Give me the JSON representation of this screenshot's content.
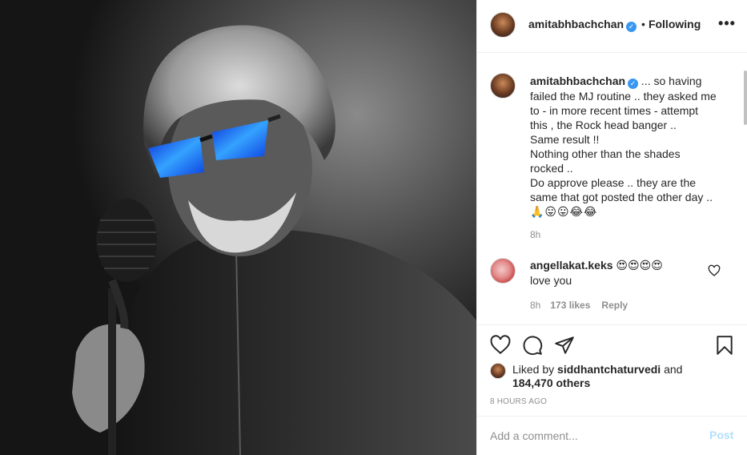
{
  "post": {
    "username": "amitabhbachchan",
    "follow_state": "Following",
    "more_icon": "more-horizontal-icon",
    "caption_lines": [
      "... so having",
      "failed the MJ routine .. they asked me",
      "to - in more recent times - attempt",
      "this , the Rock head banger ..",
      "Same result !!",
      "Nothing other than the shades",
      "rocked ..",
      "Do approve please .. they are the",
      "same that got posted the other day .."
    ],
    "caption_emojis": "🙏😛😛😂😂",
    "caption_time": "8h"
  },
  "comment": {
    "username": "angellakat.keks",
    "emojis": "😍😍😍😍",
    "text": "love you",
    "time": "8h",
    "likes": "173 likes",
    "reply": "Reply"
  },
  "likes": {
    "prefix": "Liked by",
    "by_user": "siddhantchaturvedi",
    "and": "and",
    "others": "184,470 others"
  },
  "timestamp": "8 HOURS AGO",
  "add_comment": {
    "placeholder": "Add a comment...",
    "post_label": "Post"
  },
  "colors": {
    "verified": "#3897f0",
    "muted": "#8e8e8e",
    "post_disabled": "#b2dffc",
    "glasses": "#1e7bff"
  }
}
